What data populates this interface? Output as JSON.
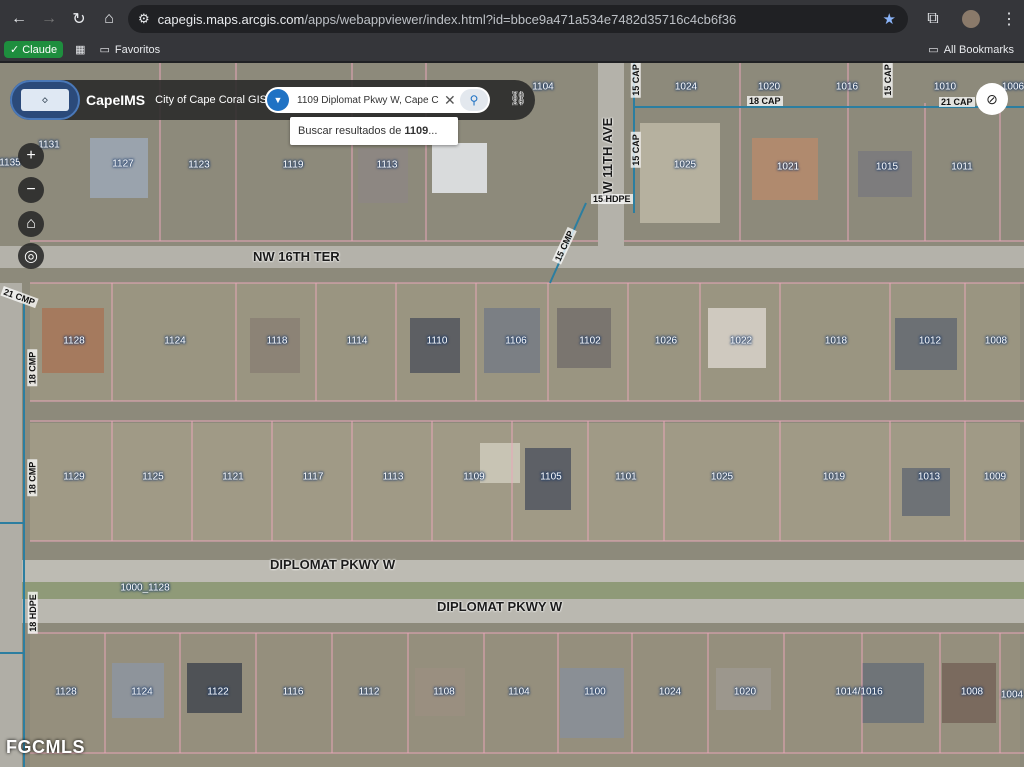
{
  "browser": {
    "url_host": "capegis.maps.arcgis.com",
    "url_path": "/apps/webappviewer/index.html?id=bbce9a471a534e7482d35716c4cb6f36",
    "bookmarks": {
      "claude": "Claude",
      "favoritos": "Favoritos",
      "all_bookmarks": "All Bookmarks"
    }
  },
  "app": {
    "title": "CapeIMS",
    "subtitle": "City of Cape Coral GIS",
    "search_value": "1109 Diplomat Pkwy W, Cape C",
    "suggestion_prefix": "Buscar resultados de ",
    "suggestion_bold": "1109",
    "suggestion_suffix": " ..."
  },
  "map": {
    "streets": {
      "nw16th": "NW 16TH TER",
      "diplomat_north": "DIPLOMAT PKWY W",
      "diplomat_south": "DIPLOMAT PKWY W",
      "nw11th": "NW 11TH AVE"
    },
    "small_streets": {
      "cap_15_top": "15 CAP",
      "cap_15_mid": "15 CAP",
      "cap_15_right": "15 CAP",
      "hdpe_15": "15 HDPE",
      "cmp_15": "15 CMP",
      "cap_18": "18 CAP",
      "cap_21": "21 CAP",
      "cmp_21": "21 CMP",
      "cmp_18_a": "18 CMP",
      "cmp_18_b": "18 CMP",
      "hdpe_18": "18 HDPE"
    },
    "parcels_row1": [
      "1135",
      "1131",
      "1127",
      "1123",
      "1119",
      "1113",
      "1104",
      "1024",
      "1020",
      "1016",
      "1010",
      "1006",
      "1025",
      "1021",
      "1015",
      "1011"
    ],
    "parcels_row2": [
      "1128",
      "1124",
      "1118",
      "1114",
      "1110",
      "1106",
      "1102",
      "1026",
      "1022",
      "1018",
      "1012",
      "1008"
    ],
    "parcels_row3": [
      "1129",
      "1125",
      "1121",
      "1117",
      "1113",
      "1109",
      "1105",
      "1101",
      "1025",
      "1019",
      "1013",
      "1009"
    ],
    "parcel_range": "1000_1128",
    "parcels_row4": [
      "1128",
      "1124",
      "1122",
      "1116",
      "1112",
      "1108",
      "1104",
      "1100",
      "1024",
      "1020",
      "1014/1016",
      "1008",
      "1004"
    ]
  },
  "watermark": "FGCMLS"
}
